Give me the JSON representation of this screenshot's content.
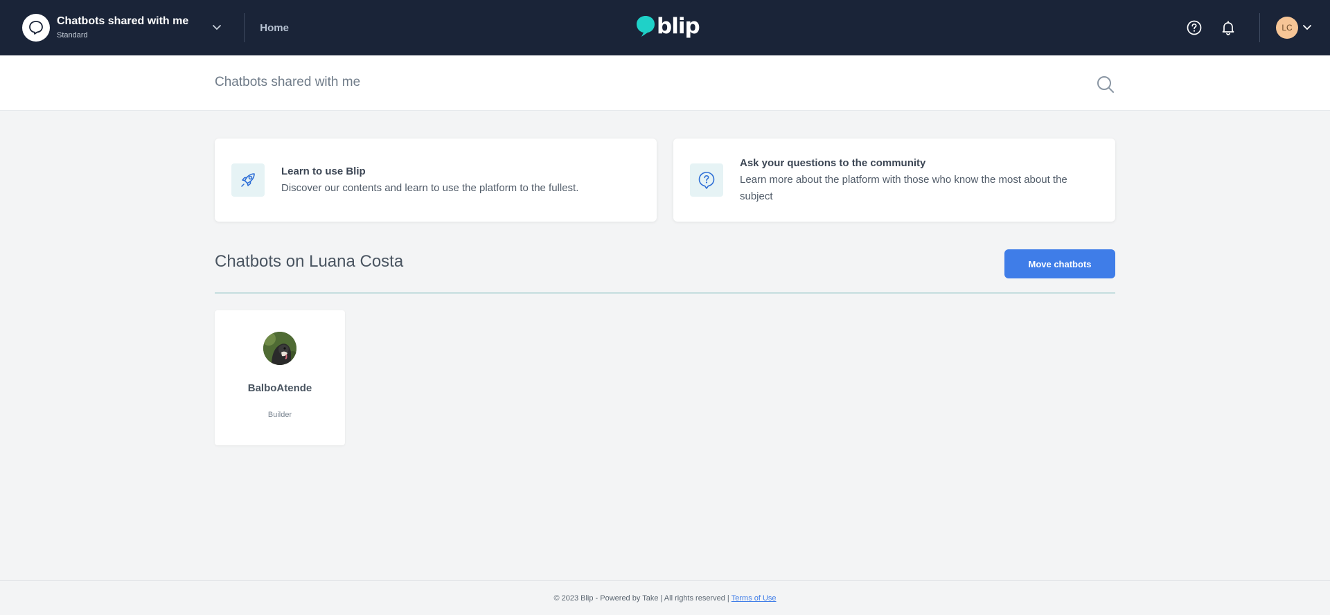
{
  "topbar": {
    "tenant_name": "Chatbots shared with me",
    "tenant_plan": "Standard",
    "home_label": "Home",
    "logo_text": "blip",
    "user_initials": "LC",
    "icons": [
      "chat-bubble-icon",
      "chevron-down-icon",
      "blip-logo-icon",
      "help-icon",
      "bell-icon",
      "chevron-down-icon"
    ]
  },
  "subheader": {
    "title": "Chatbots shared with me",
    "search_icon": "search-icon"
  },
  "cards": {
    "learn": {
      "title": "Learn to use Blip",
      "description": "Discover our contents and learn to use the platform to the fullest.",
      "icon": "rocket-icon"
    },
    "ask": {
      "title": "Ask your questions to the community",
      "description": "Learn more about the platform with those who know the most about the subject",
      "icon": "question-bubble-icon"
    }
  },
  "section": {
    "title": "Chatbots on Luana Costa",
    "move_button": "Move chatbots"
  },
  "bots": [
    {
      "name": "BalboAtende",
      "role": "Builder"
    }
  ],
  "footer": {
    "text": "© 2023 Blip - Powered by Take | All rights reserved |",
    "terms_link": "Terms of Use"
  },
  "colors": {
    "topbar_bg": "#1a2438",
    "accent": "#3f7de8",
    "logo_teal": "#1fd1c8",
    "avatar_bg": "#f6c596"
  }
}
